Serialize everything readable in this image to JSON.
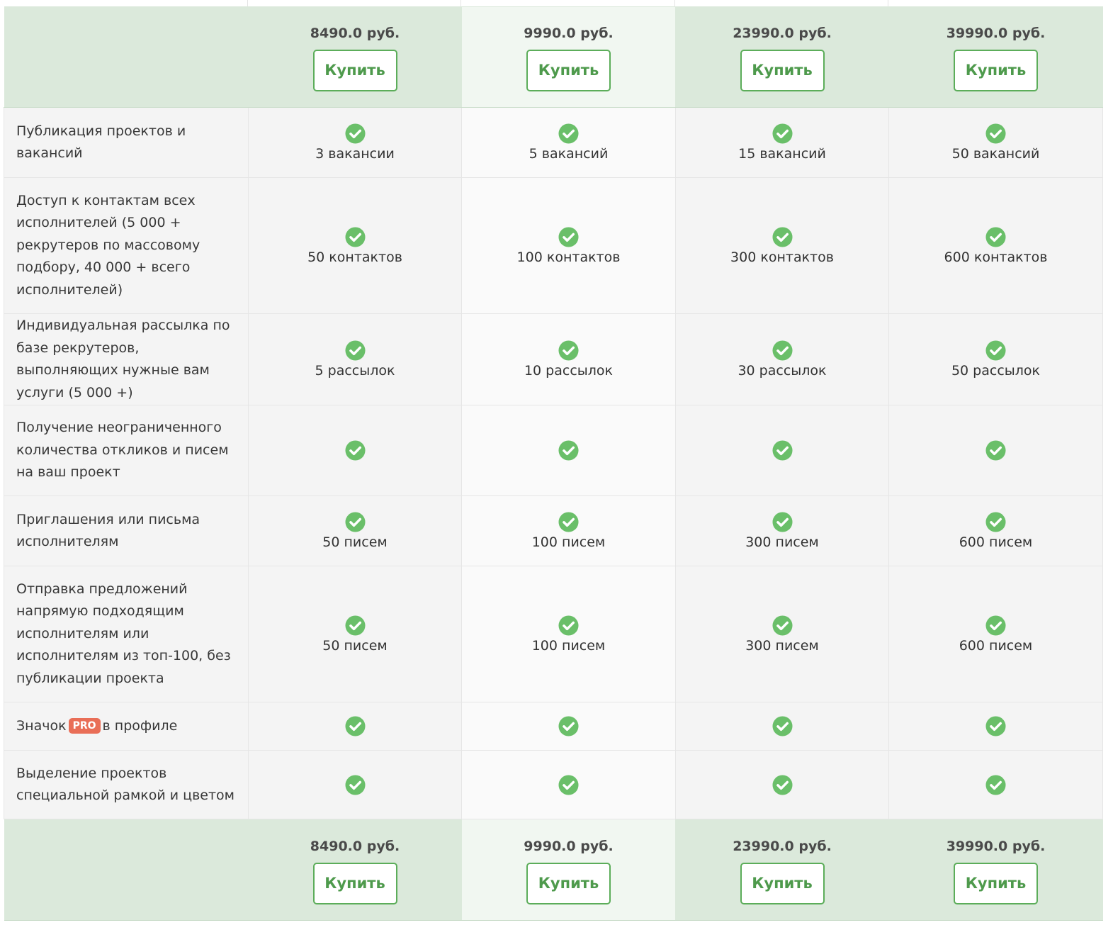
{
  "plans": [
    {
      "price": "8490.0 руб.",
      "buy_label": "Купить"
    },
    {
      "price": "9990.0 руб.",
      "buy_label": "Купить"
    },
    {
      "price": "23990.0 руб.",
      "buy_label": "Купить"
    },
    {
      "price": "39990.0 руб.",
      "buy_label": "Купить"
    }
  ],
  "features": [
    {
      "label": "Публикация проектов и вакансий",
      "values": [
        "3 вакансии",
        "5 вакансий",
        "15 вакансий",
        "50 вакансий"
      ]
    },
    {
      "label": "Доступ к контактам всех исполнителей (5 000 + рекрутеров по массовому подбору, 40 000 + всего исполнителей)",
      "values": [
        "50 контактов",
        "100 контактов",
        "300 контактов",
        "600 контактов"
      ]
    },
    {
      "label": "Индивидуальная рассылка по базе рекрутеров, выполняющих нужные вам услуги (5 000 +)",
      "values": [
        "5 рассылок",
        "10 рассылок",
        "30 рассылок",
        "50 рассылок"
      ]
    },
    {
      "label": "Получение неограниченного количества откликов и писем на ваш проект",
      "values": [
        "",
        "",
        "",
        ""
      ]
    },
    {
      "label": "Приглашения или письма исполнителям",
      "values": [
        "50 писем",
        "100 писем",
        "300 писем",
        "600 писем"
      ]
    },
    {
      "label": "Отправка предложений напрямую подходящим исполнителям или исполнителям из топ-100, без публикации проекта",
      "values": [
        "50 писем",
        "100 писем",
        "300 писем",
        "600 писем"
      ]
    },
    {
      "label_before": "Значок",
      "badge": "PRO",
      "label_after": "в профиле",
      "values": [
        "",
        "",
        "",
        ""
      ]
    },
    {
      "label": "Выделение проектов специальной рамкой и цветом",
      "values": [
        "",
        "",
        "",
        ""
      ]
    }
  ],
  "colors": {
    "accent_green": "#5cad5a",
    "check_green": "#6abf69",
    "pro_badge": "#e96e57",
    "header_bg": "#dbe9db"
  },
  "icons": {
    "check": "check-circle-icon"
  }
}
